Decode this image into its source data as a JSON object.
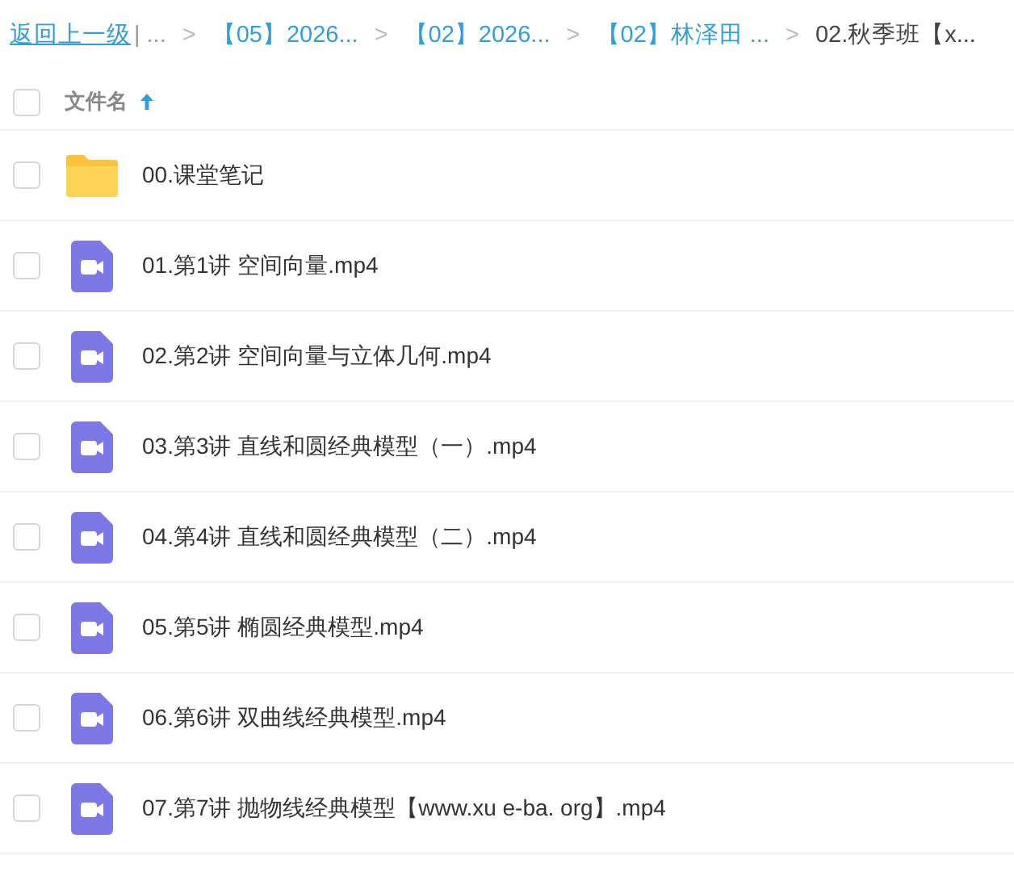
{
  "breadcrumb": [
    {
      "kind": "back",
      "text": "返回上一级"
    },
    {
      "kind": "divider",
      "text": "|"
    },
    {
      "kind": "ellipsis",
      "text": "..."
    },
    {
      "kind": "separator",
      "text": ">"
    },
    {
      "kind": "link",
      "text": "【05】2026..."
    },
    {
      "kind": "separator",
      "text": ">"
    },
    {
      "kind": "link",
      "text": "【02】2026..."
    },
    {
      "kind": "separator",
      "text": ">"
    },
    {
      "kind": "link",
      "text": "【02】林泽田 ..."
    },
    {
      "kind": "separator",
      "text": ">"
    },
    {
      "kind": "current",
      "text": "02.秋季班【x..."
    }
  ],
  "header": {
    "checked": false,
    "column": "文件名",
    "sort_ascending": true
  },
  "files": [
    {
      "kind": "folder",
      "name": "00.课堂笔记",
      "checked": false
    },
    {
      "kind": "video",
      "name": "01.第1讲 空间向量.mp4",
      "checked": false
    },
    {
      "kind": "video",
      "name": "02.第2讲 空间向量与立体几何.mp4",
      "checked": false
    },
    {
      "kind": "video",
      "name": "03.第3讲 直线和圆经典模型（一）.mp4",
      "checked": false
    },
    {
      "kind": "video",
      "name": "04.第4讲 直线和圆经典模型（二）.mp4",
      "checked": false
    },
    {
      "kind": "video",
      "name": "05.第5讲 椭圆经典模型.mp4",
      "checked": false
    },
    {
      "kind": "video",
      "name": "06.第6讲 双曲线经典模型.mp4",
      "checked": false
    },
    {
      "kind": "video",
      "name": "07.第7讲 抛物线经典模型【www.xu e-ba. org】.mp4",
      "checked": false
    }
  ]
}
